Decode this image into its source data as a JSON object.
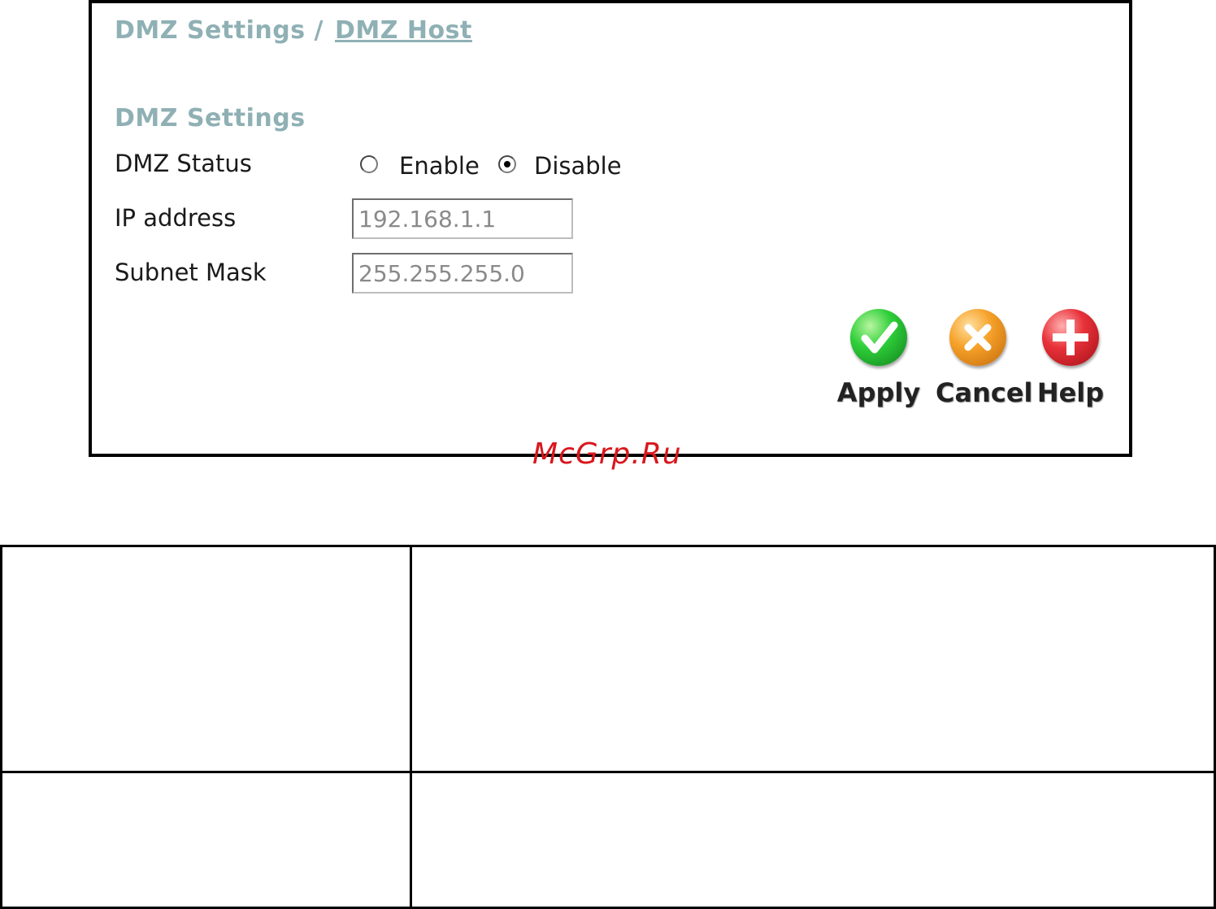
{
  "breadcrumb": {
    "parent": "DMZ Settings /",
    "current": "DMZ Host"
  },
  "section_title": "DMZ Settings",
  "dmz_status": {
    "label": "DMZ Status",
    "options": [
      {
        "label": "Enable",
        "checked": false
      },
      {
        "label": "Disable",
        "checked": true
      }
    ]
  },
  "ip_address": {
    "label": "IP address",
    "value": "192.168.1.1"
  },
  "subnet_mask": {
    "label": "Subnet Mask",
    "value": "255.255.255.0"
  },
  "buttons": {
    "apply": "Apply",
    "cancel": "Cancel",
    "help": "Help"
  },
  "icons": {
    "apply": "checkmark-icon",
    "cancel": "x-icon",
    "help": "plus-icon"
  },
  "colors": {
    "heading": "#8fb0b4",
    "apply": "#2fcf3a",
    "cancel": "#f6a22a",
    "help": "#e8323a",
    "watermark": "#d9161c"
  },
  "watermark": "McGrp.Ru"
}
